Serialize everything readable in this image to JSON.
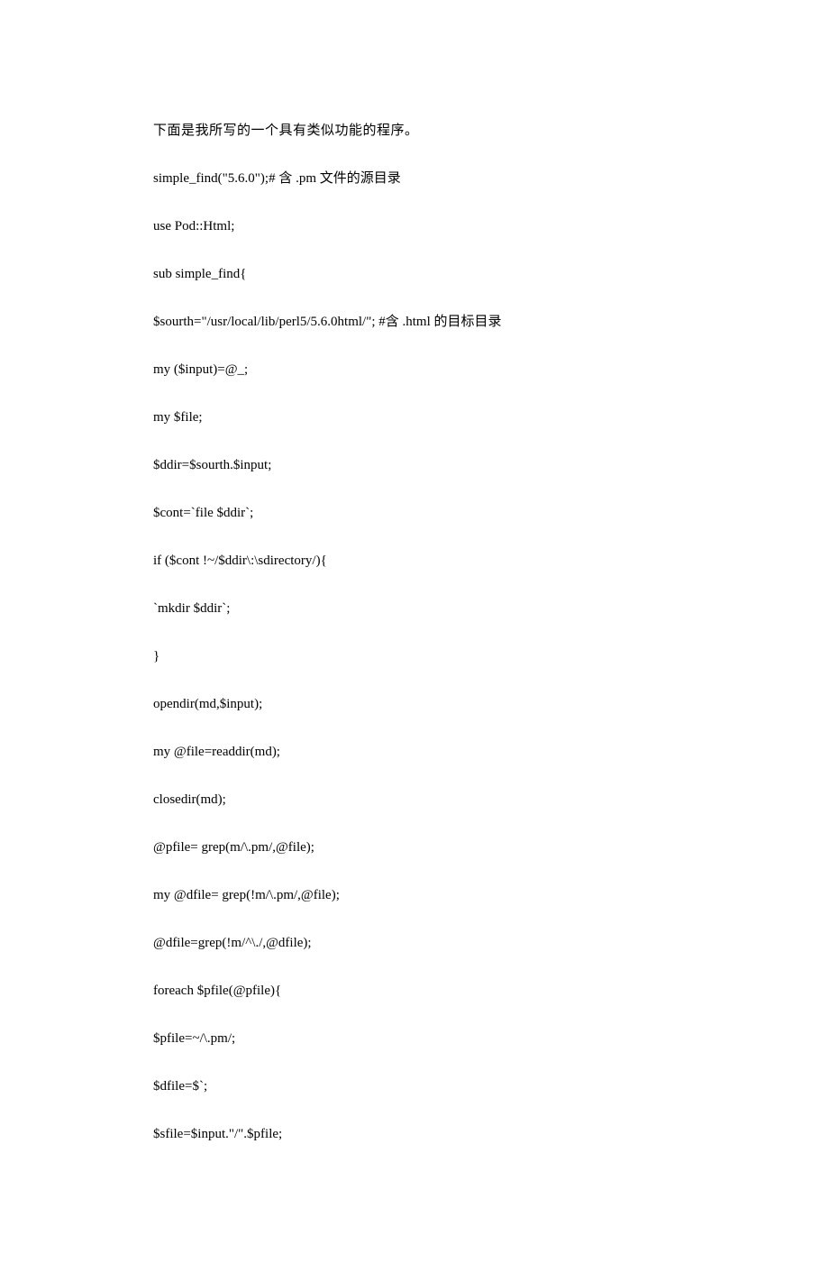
{
  "lines": [
    "下面是我所写的一个具有类似功能的程序。",
    "simple_find(\"5.6.0\");#  含  .pm  文件的源目录",
    "use Pod::Html;",
    "sub simple_find{",
    "$sourth=\"/usr/local/lib/perl5/5.6.0html/\"; #含  .html 的目标目录",
    "my ($input)=@_;",
    "my $file;",
    "$ddir=$sourth.$input;",
    "$cont=`file $ddir`;",
    "if ($cont !~/$ddir\\:\\sdirectory/){",
    "`mkdir $ddir`;",
    "}",
    "opendir(md,$input);",
    "my @file=readdir(md);",
    "closedir(md);",
    "@pfile= grep(m/\\.pm/,@file);",
    "my @dfile= grep(!m/\\.pm/,@file);",
    "@dfile=grep(!m/^\\./,@dfile);",
    "foreach $pfile(@pfile){",
    "$pfile=~/\\.pm/;",
    "$dfile=$`;",
    "$sfile=$input.\"/\".$pfile;"
  ]
}
